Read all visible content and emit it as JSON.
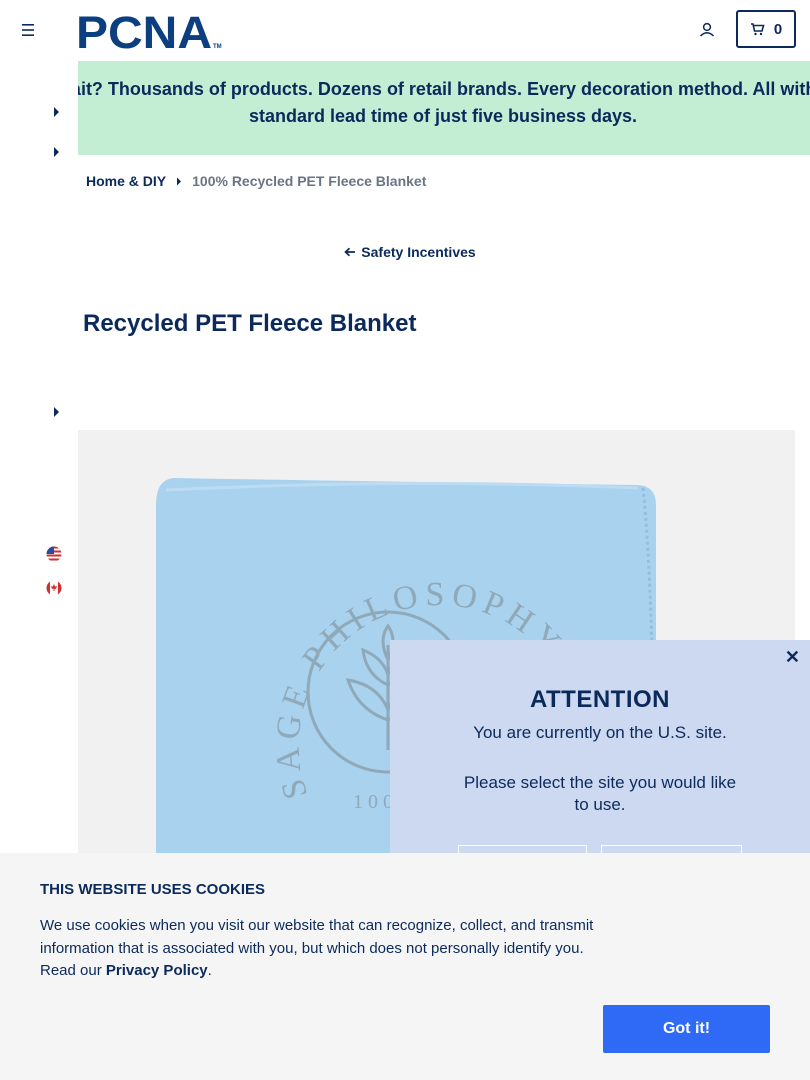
{
  "header": {
    "logo_text": "PCNA",
    "logo_tm": "TM",
    "cart_count": "0"
  },
  "promo": {
    "text": "Wait? Thousands of products. Dozens of retail brands. Every decoration method. All with a standard lead time of just five business days."
  },
  "breadcrumb": {
    "parent": "Home & DIY",
    "current": "100% Recycled PET Fleece Blanket"
  },
  "back_link": "Safety Incentives",
  "product": {
    "title": "Recycled PET Fleece Blanket",
    "print_text": "SAGE PHILOSOPHY",
    "print_sub": "100"
  },
  "locales": [
    "us-flag-icon",
    "canada-flag-icon"
  ],
  "modal": {
    "close": "✕",
    "title": "ATTENTION",
    "message": "You are currently on the U.S. site.",
    "prompt": "Please select the site you would like to use."
  },
  "cookie": {
    "title": "THIS WEBSITE USES COOKIES",
    "body": "We use cookies when you visit our website that can recognize, collect, and transmit information that is associated with you, but which does not personally identify you. Read our",
    "policy_link": "Privacy Policy",
    "period": ".",
    "button": "Got it!"
  },
  "colors": {
    "navy": "#0b2a5b",
    "promo_bg": "#c4eed3",
    "modal_bg": "#cdd8f1",
    "cookie_button": "#2f6af7",
    "blanket": "#a9d2ef"
  }
}
